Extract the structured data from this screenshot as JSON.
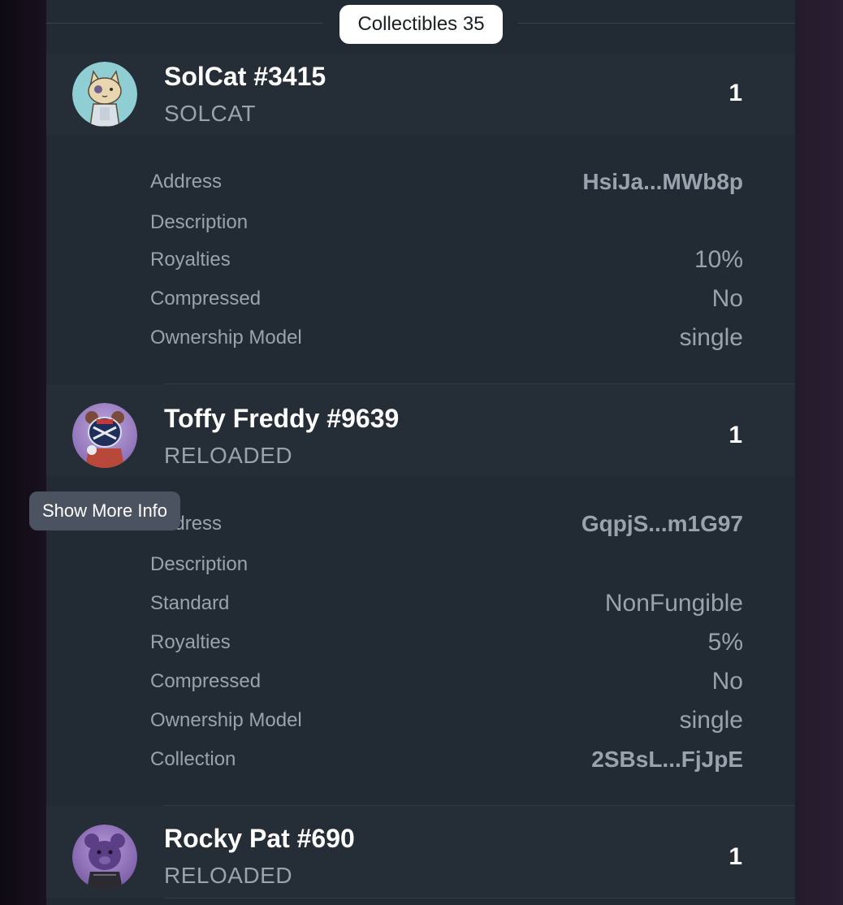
{
  "header": {
    "collectibles_label": "Collectibles 35"
  },
  "items": [
    {
      "name": "SolCat #3415",
      "collection_symbol": "SOLCAT",
      "quantity": "1",
      "details": [
        {
          "label": "Address",
          "value": "HsiJa...MWb8p"
        },
        {
          "label": "Description",
          "value": ""
        },
        {
          "label": "Royalties",
          "value": "10%"
        },
        {
          "label": "Compressed",
          "value": "No"
        },
        {
          "label": "Ownership Model",
          "value": "single"
        }
      ]
    },
    {
      "name": "Toffy Freddy #9639",
      "collection_symbol": "RELOADED",
      "quantity": "1",
      "details": [
        {
          "label": "Address",
          "value": "GqpjS...m1G97"
        },
        {
          "label": "Description",
          "value": ""
        },
        {
          "label": "Standard",
          "value": "NonFungible"
        },
        {
          "label": "Royalties",
          "value": "5%"
        },
        {
          "label": "Compressed",
          "value": "No"
        },
        {
          "label": "Ownership Model",
          "value": "single"
        },
        {
          "label": "Collection",
          "value": "2SBsL...FjJpE"
        }
      ]
    },
    {
      "name": "Rocky Pat #690",
      "collection_symbol": "RELOADED",
      "quantity": "1"
    }
  ],
  "tooltip": {
    "text": "Show More Info"
  },
  "icons": {
    "solcat_avatar": "cat-nft-icon",
    "toffy_avatar": "bear-goalie-nft-icon",
    "rocky_avatar": "purple-bear-nft-icon"
  },
  "colors": {
    "panel_bg": "#222a33",
    "item_head_bg": "#252d36",
    "muted_text": "#9aa3ad",
    "tooltip_bg": "#4b5360"
  }
}
